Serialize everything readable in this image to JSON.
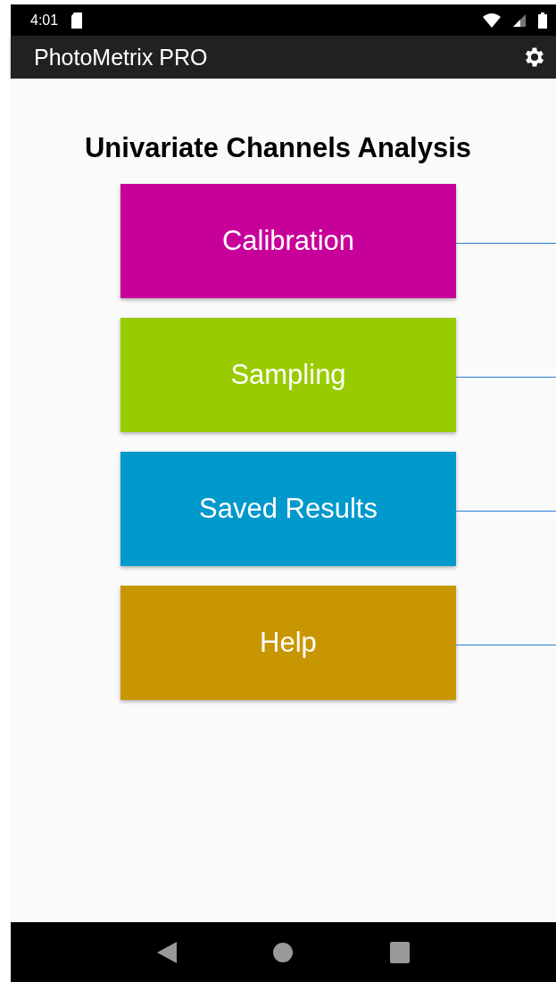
{
  "status_bar": {
    "time": "4:01"
  },
  "app_bar": {
    "title": "PhotoMetrix PRO"
  },
  "heading": "Univariate Channels Analysis",
  "buttons": [
    {
      "label": "Calibration",
      "color": "#c8009a"
    },
    {
      "label": "Sampling",
      "color": "#99cc00"
    },
    {
      "label": "Saved Results",
      "color": "#0099cc"
    },
    {
      "label": "Help",
      "color": "#c89600"
    }
  ]
}
